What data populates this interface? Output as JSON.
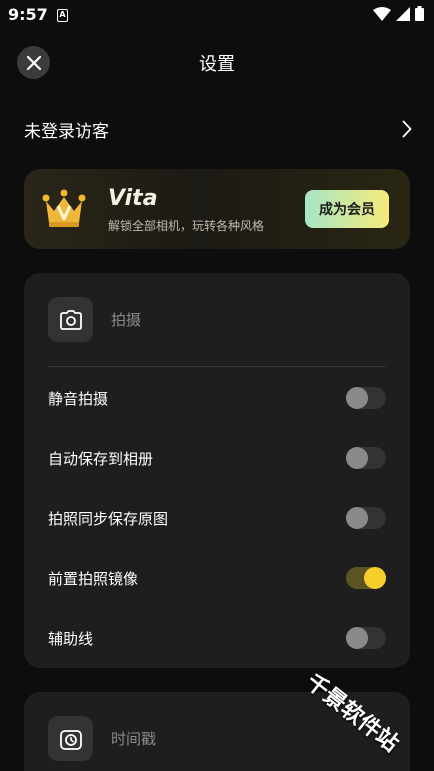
{
  "status_bar": {
    "time": "9:57",
    "notif_letter": "A"
  },
  "header": {
    "title": "设置"
  },
  "account": {
    "label": "未登录访客"
  },
  "vip": {
    "brand": "Vita",
    "subtitle": "解锁全部相机，玩转各种风格",
    "cta_label": "成为会员"
  },
  "shooting": {
    "title": "拍摄",
    "items": [
      {
        "label": "静音拍摄",
        "enabled": false
      },
      {
        "label": "自动保存到相册",
        "enabled": false
      },
      {
        "label": "拍照同步保存原图",
        "enabled": false
      },
      {
        "label": "前置拍照镜像",
        "enabled": true
      },
      {
        "label": "辅助线",
        "enabled": false
      }
    ]
  },
  "timestamp": {
    "title": "时间戳"
  },
  "watermark": {
    "text": "千景软件站"
  },
  "colors": {
    "accent": "#f6cf2a",
    "background": "#0d0d0d",
    "card": "#1e1e1e"
  }
}
